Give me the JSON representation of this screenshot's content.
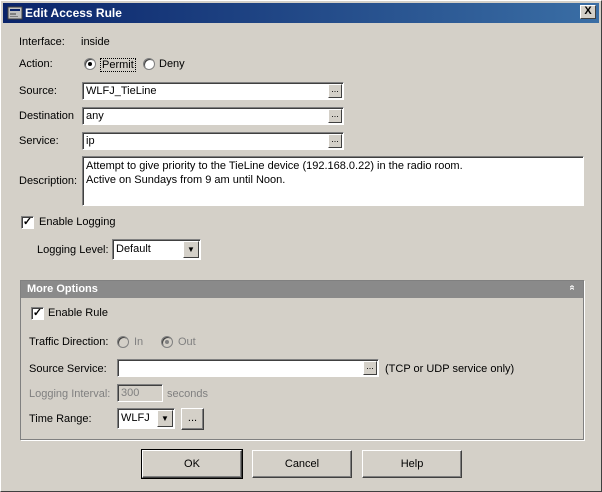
{
  "window": {
    "title": "Edit Access Rule",
    "close_glyph": "X"
  },
  "interface": {
    "label": "Interface:",
    "value": "inside"
  },
  "action": {
    "label": "Action:",
    "permit": "Permit",
    "deny": "Deny",
    "selected": "Permit"
  },
  "source": {
    "label": "Source:",
    "value": "WLFJ_TieLine"
  },
  "destination": {
    "label": "Destination",
    "value": "any"
  },
  "service": {
    "label": "Service:",
    "value": "ip"
  },
  "description": {
    "label": "Description:",
    "line1": "Attempt to give priority to the TieLine device (192.168.0.22) in the radio room.",
    "line2": "Active on Sundays from 9 am until Noon."
  },
  "logging": {
    "enable_label": "Enable Logging",
    "enabled": true,
    "level_label": "Logging Level:",
    "level_value": "Default"
  },
  "more_options": {
    "title": "More Options",
    "enable_rule_label": "Enable Rule",
    "enable_rule": true,
    "traffic_direction_label": "Traffic Direction:",
    "dir_in": "In",
    "dir_out": "Out",
    "source_service_label": "Source Service:",
    "source_service_value": "",
    "source_service_hint": "(TCP or UDP service only)",
    "logging_interval_label": "Logging Interval:",
    "logging_interval_value": "300",
    "logging_interval_unit": "seconds",
    "time_range_label": "Time Range:",
    "time_range_value": "WLFJ",
    "time_range_browse": "..."
  },
  "buttons": {
    "ok": "OK",
    "cancel": "Cancel",
    "help": "Help"
  },
  "ellipsis": "...",
  "check_glyph": "✓",
  "collapse_glyph": "«"
}
